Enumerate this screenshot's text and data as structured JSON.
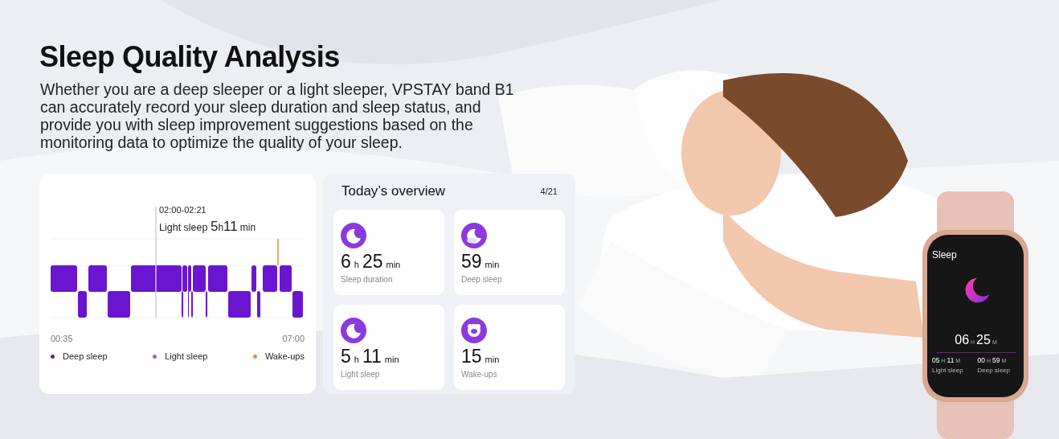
{
  "heading": "Sleep Quality Analysis",
  "description": "Whether you are a deep sleeper or a light sleeper, VPSTAY band B1 can accurately record your sleep duration and sleep status, and provide you with sleep improvement suggestions based on the monitoring data to optimize the quality of your sleep.",
  "sleep_chart": {
    "range_label": "02:00-02:21",
    "tooltip": {
      "label": "Light sleep",
      "parts": [
        {
          "text": "5",
          "kind": "number"
        },
        {
          "text": "h",
          "kind": "unit"
        },
        {
          "text": "11",
          "kind": "number"
        },
        {
          "text": "min",
          "kind": "unit"
        }
      ]
    },
    "start_time": "00:35",
    "end_time": "07:00",
    "legend": [
      {
        "label": "Deep sleep",
        "color": "#6a16d0"
      },
      {
        "label": "Light sleep",
        "color": "#a855f7"
      },
      {
        "label": "Wake-ups",
        "color": "#f08a3c"
      }
    ]
  },
  "overview": {
    "title": "Today’s overview",
    "date": "4/21",
    "stats": [
      {
        "kind": "moon",
        "label": "Sleep duration",
        "parts": [
          {
            "text": "6",
            "kind": "number"
          },
          {
            "text": "h",
            "kind": "unit"
          },
          {
            "text": "25",
            "kind": "number"
          },
          {
            "text": "min",
            "kind": "unit"
          }
        ]
      },
      {
        "kind": "moon-cloud",
        "label": "Deep sleep",
        "parts": [
          {
            "text": "59",
            "kind": "number"
          },
          {
            "text": "min",
            "kind": "unit"
          }
        ]
      },
      {
        "kind": "moon",
        "label": "Light sleep",
        "parts": [
          {
            "text": "5",
            "kind": "number"
          },
          {
            "text": "h",
            "kind": "unit"
          },
          {
            "text": "11",
            "kind": "number"
          },
          {
            "text": "min",
            "kind": "unit"
          }
        ]
      },
      {
        "kind": "sheep",
        "label": "Wake-ups",
        "parts": [
          {
            "text": "15",
            "kind": "number"
          },
          {
            "text": "min",
            "kind": "unit"
          }
        ]
      }
    ]
  },
  "watch": {
    "title": "Sleep",
    "total": [
      {
        "text": "06",
        "kind": "number"
      },
      {
        "text": "H",
        "kind": "unit"
      },
      {
        "text": "25",
        "kind": "number"
      },
      {
        "text": "M",
        "kind": "unit"
      }
    ],
    "details": [
      {
        "label": "Light sleep",
        "parts": [
          {
            "text": "05",
            "kind": "number"
          },
          {
            "text": "H",
            "kind": "unit"
          },
          {
            "text": "11",
            "kind": "number"
          },
          {
            "text": "M",
            "kind": "unit"
          }
        ]
      },
      {
        "label": "Deep sleep",
        "parts": [
          {
            "text": "00",
            "kind": "number"
          },
          {
            "text": "H",
            "kind": "unit"
          },
          {
            "text": "59",
            "kind": "number"
          },
          {
            "text": "M",
            "kind": "unit"
          }
        ]
      }
    ]
  }
}
